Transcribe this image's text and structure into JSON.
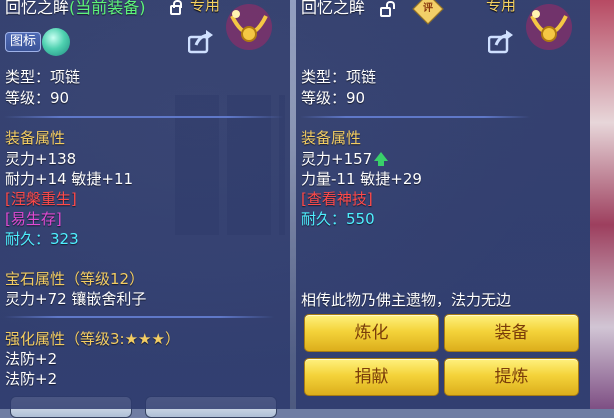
{
  "left_panel": {
    "title": "回忆之眸",
    "title_current": "(当前装备)",
    "exclusive": "专用",
    "tag_button": "图标",
    "type": "类型：项链",
    "level": "等级：90",
    "equip_attr_header": "装备属性",
    "attr_lines": [
      "灵力+138",
      "耐力+14 敏捷+11"
    ],
    "special_1": "[涅槃重生]",
    "special_2": "[易生存]",
    "durability": "耐久：323",
    "gem_header": "宝石属性（等级12）",
    "gem_line": "灵力+72 镶嵌舍利子",
    "strengthen_header": "强化属性（等级3:★★★）",
    "strengthen_lines": [
      "法防+2",
      "法防+2"
    ]
  },
  "right_panel": {
    "title": "回忆之眸",
    "seal": "评",
    "exclusive": "专用",
    "type": "类型：项链",
    "level": "等级：90",
    "equip_attr_header": "装备属性",
    "attr_line_1": "灵力+157",
    "attr_line_2": "力量-11 敏捷+29",
    "check_spirit": "[查看神技]",
    "durability": "耐久：550",
    "description": "相传此物乃佛主遗物，法力无边",
    "buttons": {
      "refine": "炼化",
      "equip": "装备",
      "donate": "捐献",
      "extract": "提炼"
    }
  },
  "colors": {
    "section_header": "#f3cd63",
    "special_red": "#ff4a4a",
    "special_pink": "#e04bd3",
    "durability_cyan": "#4ff0ff",
    "current_green": "#5ef57a",
    "gold_button": "#f4d33a"
  },
  "icons": {
    "lock": "lock-icon",
    "unlock": "unlock-icon",
    "share": "share-icon",
    "necklace": "necklace-icon",
    "gem": "gem-icon",
    "upgrade": "arrow-up-icon"
  }
}
